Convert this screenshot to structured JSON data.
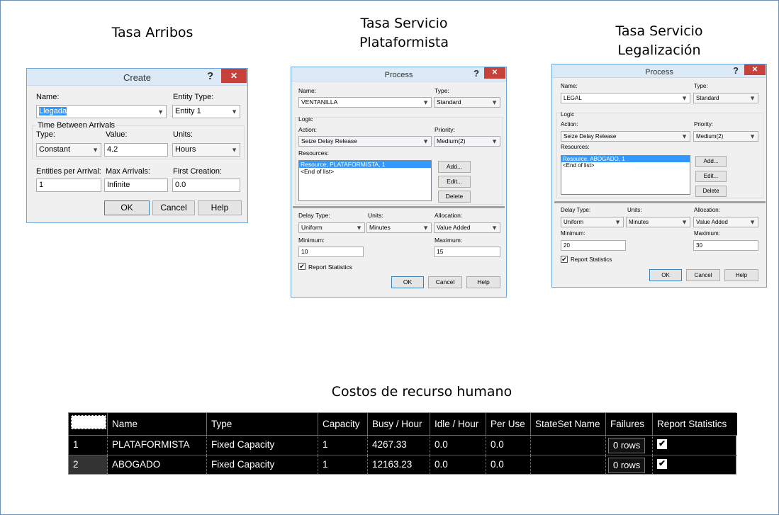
{
  "titles": {
    "arribos": "Tasa Arribos",
    "plataformista_line1": "Tasa Servicio",
    "plataformista_line2": "Plataformista",
    "legalizacion_line1": "Tasa Servicio",
    "legalizacion_line2": "Legalización",
    "costos": "Costos de recurso humano"
  },
  "create_dialog": {
    "title": "Create",
    "help_glyph": "?",
    "close_glyph": "✕",
    "name_label": "Name:",
    "name_value": "Llegada",
    "entity_type_label": "Entity Type:",
    "entity_type_value": "Entity 1",
    "group_label": "Time Between Arrivals",
    "type_label": "Type:",
    "type_value": "Constant",
    "value_label": "Value:",
    "value_value": "4.2",
    "units_label": "Units:",
    "units_value": "Hours",
    "entities_label": "Entities per Arrival:",
    "entities_value": "1",
    "max_label": "Max Arrivals:",
    "max_value": "Infinite",
    "first_label": "First Creation:",
    "first_value": "0.0",
    "ok": "OK",
    "cancel": "Cancel",
    "help": "Help"
  },
  "process_ventanilla": {
    "title": "Process",
    "help_glyph": "?",
    "close_glyph": "✕",
    "name_label": "Name:",
    "name_value": "VENTANILLA",
    "type_label": "Type:",
    "type_value": "Standard",
    "logic_label": "Logic",
    "action_label": "Action:",
    "action_value": "Seize Delay Release",
    "priority_label": "Priority:",
    "priority_value": "Medium(2)",
    "resources_label": "Resources:",
    "resource_item": "Resource, PLATAFORMISTA, 1",
    "end_item": "<End of list>",
    "add": "Add...",
    "edit": "Edit...",
    "delete": "Delete",
    "delay_label": "Delay Type:",
    "delay_value": "Uniform",
    "units_label": "Units:",
    "units_value": "Minutes",
    "alloc_label": "Allocation:",
    "alloc_value": "Value Added",
    "min_label": "Minimum:",
    "min_value": "10",
    "max_label": "Maximum:",
    "max_value": "15",
    "report_label": "Report Statistics",
    "ok": "OK",
    "cancel": "Cancel",
    "help": "Help"
  },
  "process_legal": {
    "title": "Process",
    "help_glyph": "?",
    "close_glyph": "✕",
    "name_label": "Name:",
    "name_value": "LEGAL",
    "type_label": "Type:",
    "type_value": "Standard",
    "logic_label": "Logic",
    "action_label": "Action:",
    "action_value": "Seize Delay Release",
    "priority_label": "Priority:",
    "priority_value": "Medium(2)",
    "resources_label": "Resources:",
    "resource_item": "Resource, ABOGADO, 1",
    "end_item": "<End of list>",
    "add": "Add...",
    "edit": "Edit...",
    "delete": "Delete",
    "delay_label": "Delay Type:",
    "delay_value": "Uniform",
    "units_label": "Units:",
    "units_value": "Minutes",
    "alloc_label": "Allocation:",
    "alloc_value": "Value Added",
    "min_label": "Minimum:",
    "min_value": "20",
    "max_label": "Maximum:",
    "max_value": "30",
    "report_label": "Report Statistics",
    "ok": "OK",
    "cancel": "Cancel",
    "help": "Help"
  },
  "resource_table": {
    "headers": [
      "Name",
      "Type",
      "Capacity",
      "Busy / Hour",
      "Idle / Hour",
      "Per Use",
      "StateSet Name",
      "Failures",
      "Report Statistics"
    ],
    "rows": [
      {
        "num": "1",
        "name": "PLATAFORMISTA",
        "type": "Fixed Capacity",
        "capacity": "1",
        "busy": "4267.33",
        "idle": "0.0",
        "per_use": "0.0",
        "stateset": "",
        "failures": "0 rows",
        "report": "✔"
      },
      {
        "num": "2",
        "name": "ABOGADO",
        "type": "Fixed Capacity",
        "capacity": "1",
        "busy": "12163.23",
        "idle": "0.0",
        "per_use": "0.0",
        "stateset": "",
        "failures": "0 rows",
        "report": "✔"
      }
    ]
  }
}
